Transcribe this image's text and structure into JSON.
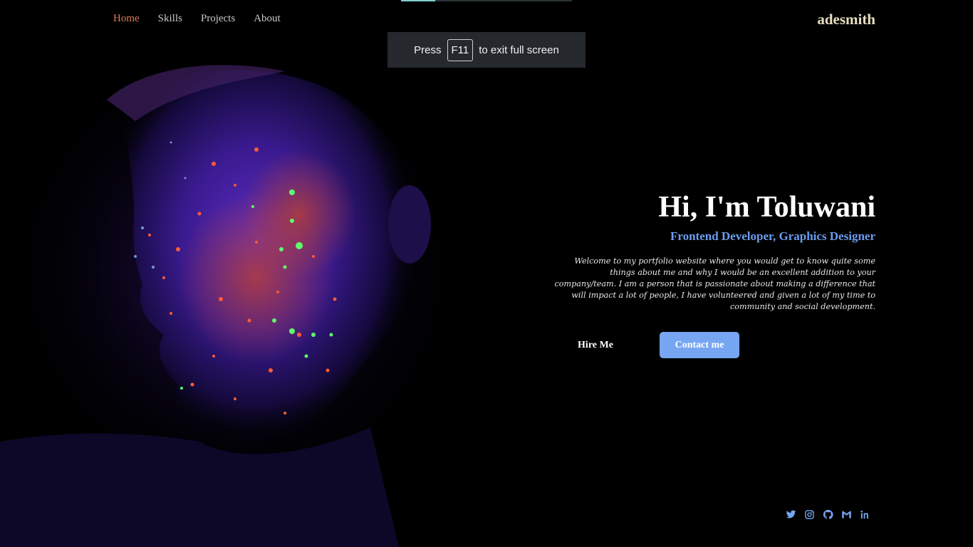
{
  "nav": {
    "items": [
      {
        "label": "Home",
        "active": true
      },
      {
        "label": "Skills",
        "active": false
      },
      {
        "label": "Projects",
        "active": false
      },
      {
        "label": "About",
        "active": false
      }
    ]
  },
  "brand": "adesmith",
  "fullscreen_toast": {
    "prefix": "Press",
    "key": "F11",
    "suffix": "to exit full screen"
  },
  "hero": {
    "title": "Hi, I'm Toluwani",
    "subtitle": "Frontend Developer, Graphics Designer",
    "description": "Welcome to my portfolio website where you would get to know quite some things about me and why I would be an excellent addition to your company/team. I am a person that is passionate about making a difference that will impact a lot of people, I have volunteered and given a lot of my time to community and social development.",
    "hire_label": "Hire Me",
    "contact_label": "Contact me"
  },
  "socials": [
    "twitter-icon",
    "instagram-icon",
    "github-icon",
    "gmail-icon",
    "linkedin-icon"
  ],
  "colors": {
    "background": "#000000",
    "nav_active": "#e07a5f",
    "accent": "#76a6f2",
    "subtitle": "#6b9cf0",
    "brand": "#e8dcc0"
  }
}
